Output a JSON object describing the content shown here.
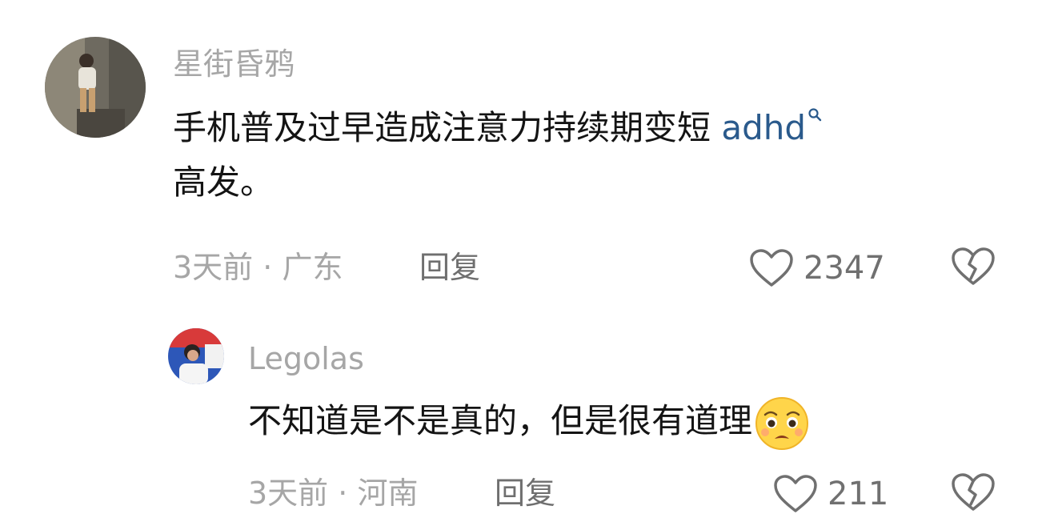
{
  "comments": [
    {
      "username": "星街昏鸦",
      "text_main": "手机普及过早造成注意力持续期变短 ",
      "hashtag": "adhd",
      "text_tail": "高发。",
      "time": "3天前",
      "separator": " · ",
      "location": "广东",
      "reply_label": "回复",
      "likes": "2347",
      "avatar_icon": "user-photo-avatar"
    },
    {
      "username": "Legolas",
      "text_main": "不知道是不是真的，但是很有道理",
      "emoji": "pleading-face-emoji",
      "time": "3天前",
      "separator": " · ",
      "location": "河南",
      "reply_label": "回复",
      "likes": "211",
      "avatar_icon": "user-photo-avatar"
    }
  ],
  "colors": {
    "meta_gray": "#a6a6a6",
    "hashtag_blue": "#2a5a8c",
    "icon_gray": "#707070"
  }
}
